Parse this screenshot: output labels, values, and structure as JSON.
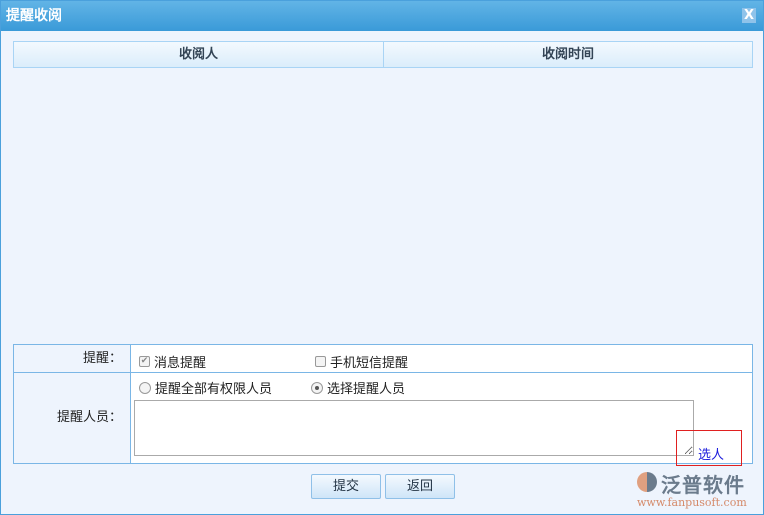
{
  "dialog": {
    "title": "提醒收阅",
    "close_label": "X"
  },
  "table": {
    "columns": [
      "收阅人",
      "收阅时间"
    ],
    "rows": []
  },
  "form": {
    "remind_label": "提醒：",
    "msg_remind": {
      "label": "消息提醒",
      "checked": true,
      "disabled": true
    },
    "sms_remind": {
      "label": "手机短信提醒",
      "checked": false
    },
    "people_label": "提醒人员：",
    "radio_all": {
      "label": "提醒全部有权限人员",
      "selected": false
    },
    "radio_select": {
      "label": "选择提醒人员",
      "selected": true
    },
    "people_value": "",
    "pick_link": "选人"
  },
  "buttons": {
    "submit": "提交",
    "back": "返回"
  },
  "watermark": {
    "name": "泛普软件",
    "url": "www.fanpusoft.com"
  }
}
